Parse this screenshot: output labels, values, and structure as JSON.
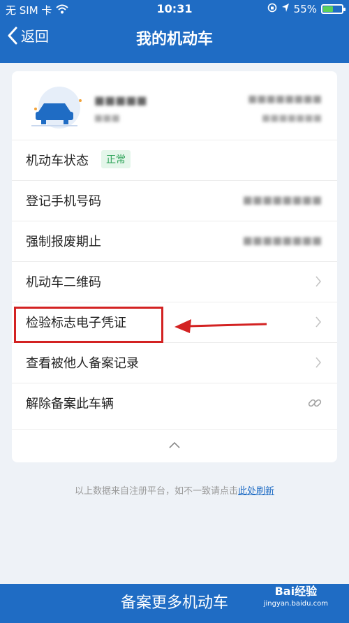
{
  "status_bar": {
    "carrier": "无 SIM 卡",
    "time": "10:31",
    "battery": "55%",
    "battery_level": 0.55,
    "battery_color": "#5ad05a"
  },
  "nav": {
    "back_label": "返回",
    "title": "我的机动车"
  },
  "vehicle": {
    "plate": "■■■■■",
    "plate_sub": "■■■",
    "vin": "■■■■■■■■",
    "vin_sub": "■■■■■■■"
  },
  "rows": [
    {
      "label": "机动车状态",
      "badge": "正常"
    },
    {
      "label": "登记手机号码",
      "value": "■■■■■■■■"
    },
    {
      "label": "强制报废期止",
      "value": "■■■■■■■■"
    },
    {
      "label": "机动车二维码"
    },
    {
      "label": "检验标志电子凭证"
    },
    {
      "label": "查看被他人备案记录"
    },
    {
      "label": "解除备案此车辆"
    }
  ],
  "footer_note": {
    "text": "以上数据来自注册平台，如不一致请点击",
    "link": "此处刷新"
  },
  "bottom_button": "备案更多机动车",
  "watermark": {
    "brand": "Bai经验",
    "url": "jingyan.baidu.com"
  },
  "colors": {
    "brand_blue": "#1f6cc4",
    "badge_green": "#2fa45a",
    "highlight_red": "#d32222"
  }
}
